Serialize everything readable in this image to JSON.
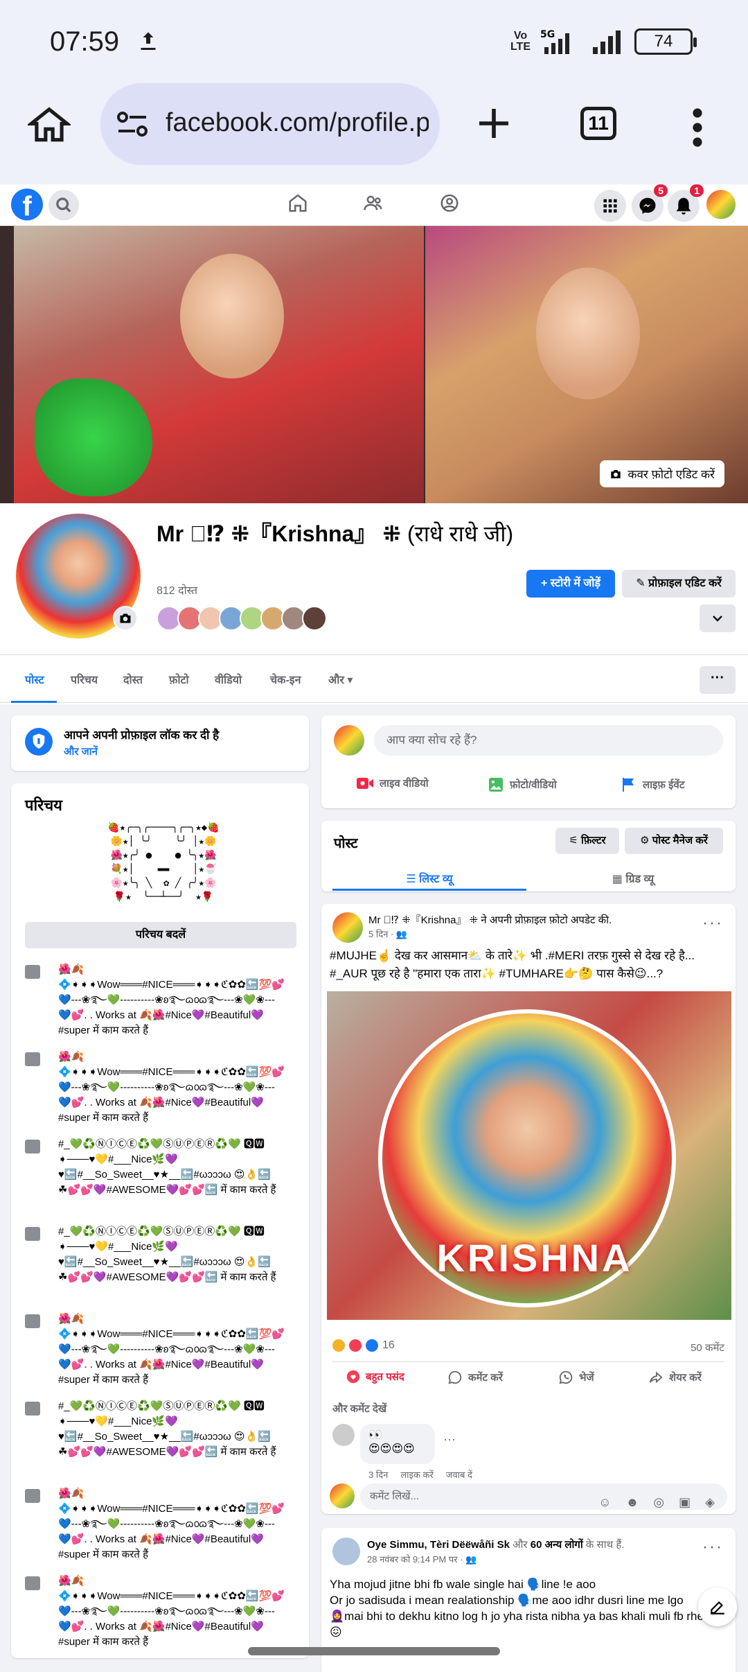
{
  "status_bar": {
    "time": "07:59",
    "network": "VoLTE 5G",
    "battery": "74"
  },
  "browser": {
    "url": "facebook.com/profile.ph",
    "tab_count": "11"
  },
  "fb_nav": {
    "messenger_badge": "5",
    "notification_badge": "1"
  },
  "cover": {
    "edit_label": "कवर फ़ोटो एडिट करें"
  },
  "profile": {
    "name_main": "Mr ⃝⁉ ⁜『Krishna』 ⁜ ",
    "name_suffix": "(राधे राधे जी)",
    "friends": "812 दोस्त",
    "add_story": "+ स्टोरी में जोड़ें",
    "edit_profile": "✎ प्रोफ़ाइल एडिट करें"
  },
  "tabs": [
    "पोस्ट",
    "परिचय",
    "दोस्त",
    "फ़ोटो",
    "वीडियो",
    "चेक-इन",
    "और ▾"
  ],
  "lock_notice": {
    "title": "आपने अपनी प्रोफ़ाइल लॉक कर दी है",
    "link": "और जानें"
  },
  "intro": {
    "title": "परिचय",
    "ascii_art": "🍓★╭─╮╭────╮╭─╮★◆🍓\n🌼★│ ╰╯    ╰╯ │★🌼\n🌺★╭╯ ●    ● ╰╮★🌺\n💐★│    ▬▬    │★🍧\n🌸★╰╮ ╲  ✿ ╱ ╭╯★🌸\n🌹★  ╰──┴──╯  ★🌹",
    "edit_button": "परिचय बदलें",
    "work_items": [
      "🌺🍂\n💠➧➧➧Wow═══#NICE═══➧➧➧ℭ✿✿🔙💯💕\n💙---❀࿐💚----------❀ʚ࿐ɷ൦ɷ࿐---❀💚❀---\n💙💕. . Works at 🍂🌺#Nice💜#Beautiful💜\n#super में काम करते हैं",
      "🌺🍂\n💠➧➧➧Wow═══#NICE═══➧➧➧ℭ✿✿🔙💯💕\n💙---❀࿐💚----------❀ʚ࿐ɷ൦ɷ࿐---❀💚❀---\n💙💕. . Works at 🍂🌺#Nice💜#Beautiful💜\n#super में काम करते हैं",
      "#_💚♻️ⓃⒾⒸⒺ♻️💚ⓈⓊⓅⒺⓇ♻️💚 🆀🆆\n➧───♥💛#___Nice🌿💜\n♥🔙#__So_Sweet__♥★__🔙#ωↄↄↄω 😍👌🔙\n☘💕💕💜#AWESOME💜💕💕🔙 में काम करते हैं",
      "#_💚♻️ⓃⒾⒸⒺ♻️💚ⓈⓊⓅⒺⓇ♻️💚 🆀🆆\n➧───♥💛#___Nice🌿💜\n♥🔙#__So_Sweet__♥★__🔙#ωↄↄↄω 😍👌🔙\n☘💕💕💜#AWESOME💜💕💕🔙 में काम करते हैं",
      "🌺🍂\n💠➧➧➧Wow═══#NICE═══➧➧➧ℭ✿✿🔙💯💕\n💙---❀࿐💚----------❀ʚ࿐ɷ൦ɷ࿐---❀💚❀---\n💙💕. . Works at 🍂🌺#Nice💜#Beautiful💜\n#super में काम करते हैं",
      "#_💚♻️ⓃⒾⒸⒺ♻️💚ⓈⓊⓅⒺⓇ♻️💚 🆀🆆\n➧───♥💛#___Nice🌿💜\n♥🔙#__So_Sweet__♥★__🔙#ωↄↄↄω 😍👌🔙\n☘💕💕💜#AWESOME💜💕💕🔙 में काम करते हैं",
      "🌺🍂\n💠➧➧➧Wow═══#NICE═══➧➧➧ℭ✿✿🔙💯💕\n💙---❀࿐💚----------❀ʚ࿐ɷ൦ɷ࿐---❀💚❀---\n💙💕. . Works at 🍂🌺#Nice💜#Beautiful💜\n#super में काम करते हैं",
      "🌺🍂\n💠➧➧➧Wow═══#NICE═══➧➧➧ℭ✿✿🔙💯💕\n💙---❀࿐💚----------❀ʚ࿐ɷ൦ɷ࿐---❀💚❀---\n💙💕. . Works at 🍂🌺#Nice💜#Beautiful💜\n#super में काम करते हैं"
    ]
  },
  "composer": {
    "placeholder": "आप क्या सोच रहे हैं?",
    "live": "लाइव वीडियो",
    "photo": "फ़ोटो/वीडियो",
    "event": "लाइफ़ ईवेंट"
  },
  "posts_header": {
    "title": "पोस्ट",
    "filter": "फ़िल्टर",
    "manage": "पोस्ट मैनेज करें",
    "list_view": "लिस्ट व्यू",
    "grid_view": "ग्रिड व्यू"
  },
  "post1": {
    "author": "Mr ⃝⁉ ⁜『Krishna』 ⁜ ने अपनी प्रोफ़ाइल फ़ोटो अपडेट की.",
    "meta": "5 दिन · 👥",
    "line1": "#MUJHE☝️ देख कर आसमान⛅ के तारे✨ भी .#MERI तरफ़ गुस्से से देख रहे है...",
    "line2": "#_AUR पूछ रहे है \"हमारा एक तारा✨ #TUMHARE👉🤔 पास कैसे😉...?",
    "image_text": "KRISHNA",
    "reaction_count": "16",
    "comment_count": "50 कमेंट",
    "like": "बहुत पसंद",
    "comment": "कमेंट करें",
    "send": "भेजें",
    "share": "शेयर करें",
    "more_comments": "और कमेंट देखें",
    "comment_emoji": "👀\n😍😍😍😍",
    "comment_time": "3 दिन",
    "comment_like": "लाइक करें",
    "comment_reply": "जवाब दें",
    "write_comment": "कमेंट लिखें..."
  },
  "post2": {
    "author_a": "Oye Simmu",
    "author_b": ", Tèri Dëëwåñi Sk",
    "author_c": " और ",
    "author_d": "60 अन्य लोगों",
    "author_e": " के साथ हैं.",
    "meta": "28 नवंबर को 9:14 PM पर · 👥",
    "text": "Yha mojud jitne bhi fb wale single hai 🗣️line !e aoo\nOr jo sadisuda i mean realationship 🗣️me aoo idhr dusri line me lgo\n🧕mai bhi to dekhu kitno log h jo yha rista nibha ya bas khali muli fb rhe 😖"
  }
}
